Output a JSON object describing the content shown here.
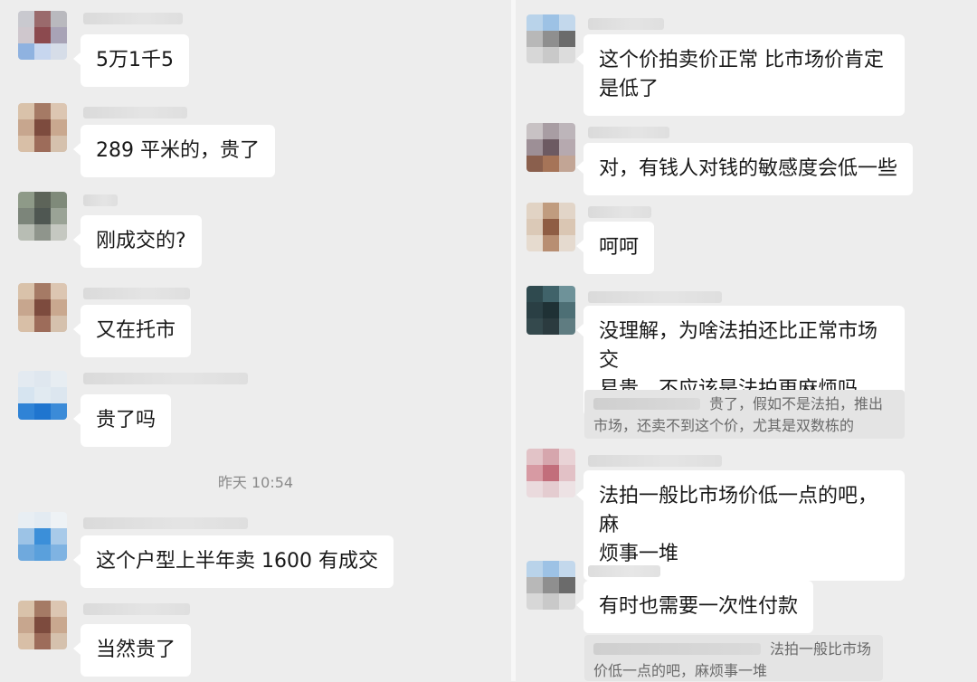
{
  "timestamp": "昨天 10:54",
  "left_messages": [
    {
      "text": "5万1千5"
    },
    {
      "text": "289 平米的，贵了"
    },
    {
      "text": "刚成交的?"
    },
    {
      "text": "又在托市"
    },
    {
      "text": "贵了吗"
    },
    {
      "text": "这个户型上半年卖 1600 有成交"
    },
    {
      "text": "当然贵了"
    }
  ],
  "right_messages": [
    {
      "text": "这个价拍卖价正常 比市场价肯定\n是低了"
    },
    {
      "text": "对，有钱人对钱的敏感度会低一些"
    },
    {
      "text": "呵呵"
    },
    {
      "text": "没理解，为啥法拍还比正常市场交\n易贵。不应该是法拍更麻烦吗"
    },
    {
      "text": "法拍一般比市场价低一点的吧，麻\n烦事一堆"
    },
    {
      "text": "有时也需要一次性付款"
    }
  ],
  "quotes": [
    {
      "line1": "贵了，假如不是法拍，推出",
      "line2": "市场，还卖不到这个价，尤其是双数栋的"
    },
    {
      "line1": "法拍一般比市场",
      "line2": "价低一点的吧，麻烦事一堆"
    }
  ]
}
